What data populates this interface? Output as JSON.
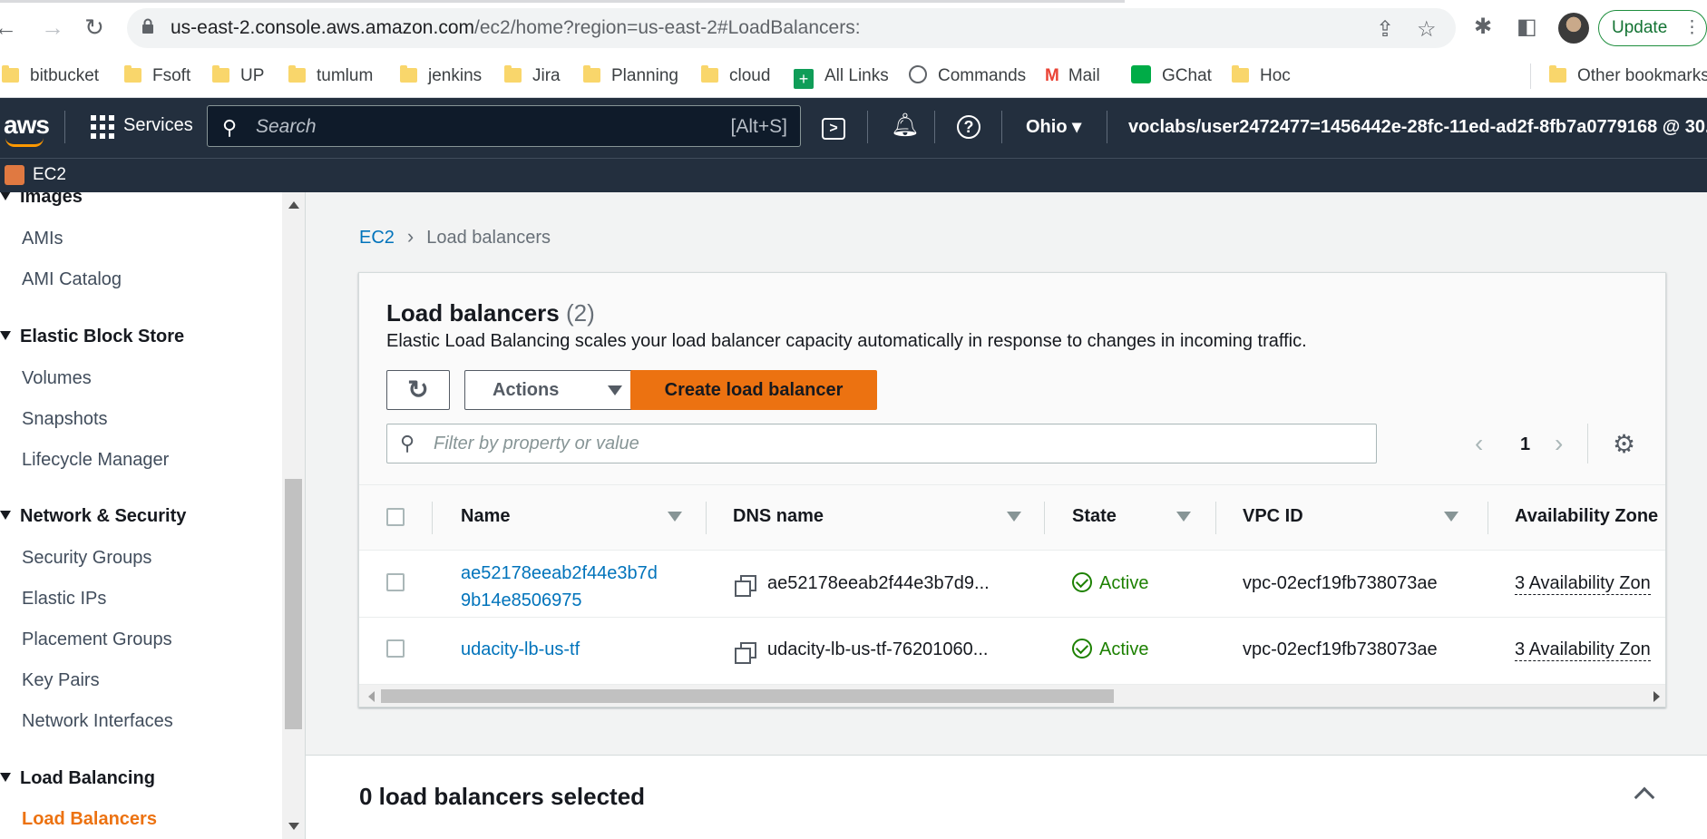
{
  "browser": {
    "url_host": "us-east-2.console.aws.amazon.com",
    "url_path": "/ec2/home?region=us-east-2#LoadBalancers:",
    "update_label": "Update"
  },
  "bookmarks": [
    "bitbucket",
    "Fsoft",
    "UP",
    "tumlum",
    "jenkins",
    "Jira",
    "Planning",
    "cloud",
    "All Links",
    "Commands",
    "Mail",
    "GChat",
    "Hoc",
    "Other bookmarks"
  ],
  "aws": {
    "logo": "aws",
    "services_label": "Services",
    "search_placeholder": "Search",
    "search_shortcut": "[Alt+S]",
    "region": "Ohio",
    "account": "voclabs/user2472477=1456442e-28fc-11ed-ad2f-8fb7a0779168 @ 30...",
    "service_name": "EC2"
  },
  "sidebar": {
    "top_partial": "Images",
    "links_images": [
      "AMIs",
      "AMI Catalog"
    ],
    "ebs_title": "Elastic Block Store",
    "links_ebs": [
      "Volumes",
      "Snapshots",
      "Lifecycle Manager"
    ],
    "netsec_title": "Network & Security",
    "links_netsec": [
      "Security Groups",
      "Elastic IPs",
      "Placement Groups",
      "Key Pairs",
      "Network Interfaces"
    ],
    "lb_title": "Load Balancing",
    "active_link": "Load Balancers"
  },
  "breadcrumb": {
    "root": "EC2",
    "current": "Load balancers"
  },
  "panel": {
    "title": "Load balancers",
    "count": "(2)",
    "description": "Elastic Load Balancing scales your load balancer capacity automatically in response to changes in incoming traffic.",
    "actions_label": "Actions",
    "create_label": "Create load balancer",
    "filter_placeholder": "Filter by property or value",
    "page": "1"
  },
  "table": {
    "columns": [
      "Name",
      "DNS name",
      "State",
      "VPC ID",
      "Availability Zone"
    ],
    "rows": [
      {
        "name_line1": "ae52178eeab2f44e3b7d",
        "name_line2": "9b14e8506975",
        "dns": "ae52178eeab2f44e3b7d9...",
        "state": "Active",
        "vpc": "vpc-02ecf19fb738073ae",
        "az": "3 Availability Zon"
      },
      {
        "name_line1": "udacity-lb-us-tf",
        "name_line2": "",
        "dns": "udacity-lb-us-tf-76201060...",
        "state": "Active",
        "vpc": "vpc-02ecf19fb738073ae",
        "az": "3 Availability Zon"
      }
    ]
  },
  "selection": {
    "label": "0 load balancers selected"
  },
  "icons": {
    "brand_orange": "#ec7211",
    "link_blue": "#0073bb",
    "active_green": "#1d8102",
    "aws_nav": "#232f3e"
  }
}
